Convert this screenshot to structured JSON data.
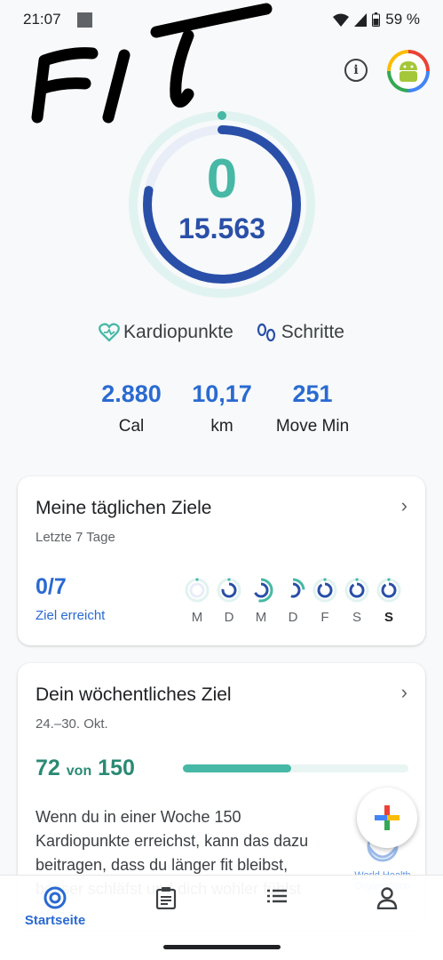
{
  "status_bar": {
    "time": "21:07",
    "battery": "59 %"
  },
  "overlay": {
    "text": "FIT"
  },
  "ring": {
    "heart_points": "0",
    "steps": "15.563",
    "heart_progress": 0.0,
    "steps_progress": 0.78
  },
  "legend": {
    "heart_label": "Kardiopunkte",
    "steps_label": "Schritte"
  },
  "stats": [
    {
      "value": "2.880",
      "label": "Cal"
    },
    {
      "value": "10,17",
      "label": "km"
    },
    {
      "value": "251",
      "label": "Move Min"
    }
  ],
  "daily_goals": {
    "title": "Meine täglichen Ziele",
    "subtitle": "Letzte 7 Tage",
    "value": "0/7",
    "value_label": "Ziel erreicht",
    "days": [
      "M",
      "D",
      "M",
      "D",
      "F",
      "S",
      "S"
    ]
  },
  "weekly_goal": {
    "title": "Dein wöchentliches Ziel",
    "date_range": "24.–30. Okt.",
    "current": "72",
    "von": "von",
    "target": "150",
    "progress": 0.48,
    "text": "Wenn du in einer Woche 150 Kardiopunkte erreichst, kann das dazu beitragen, dass du länger fit bleibst, besser schläfst und dich wohler fühlst",
    "who": "World Health Organization"
  },
  "bottom_nav": {
    "home_label": "Startseite"
  },
  "colors": {
    "accent_blue": "#2a6ad1",
    "ring_blue": "#2a4fa8",
    "teal": "#46b8a5"
  }
}
